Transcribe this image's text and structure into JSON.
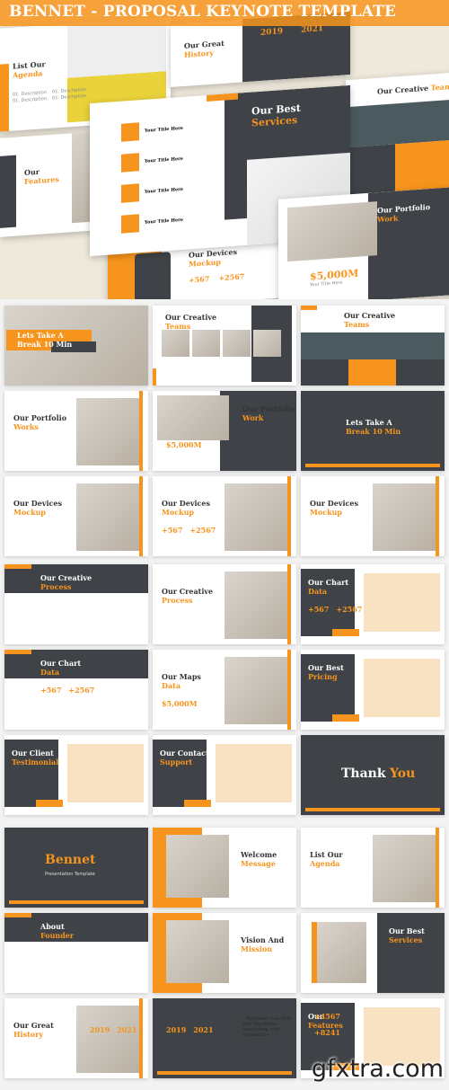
{
  "header": {
    "title": "BENNET - PROPOSAL KEYNOTE TEMPLATE"
  },
  "hero": {
    "agenda": {
      "t1": "List Our",
      "t2": "Agenda",
      "items": [
        "01. Description",
        "01. Description",
        "01. Description",
        "01. Description"
      ]
    },
    "history": {
      "t1": "Our Great",
      "t2": "History",
      "years": [
        "2019",
        "2021"
      ]
    },
    "services": {
      "t1": "Our Best",
      "t2": "Services",
      "items": [
        "Your Title Here",
        "Your Title Here",
        "Your Title Here",
        "Your Title Here"
      ]
    },
    "team": {
      "t1": "Our Creative",
      "t2": "Team"
    },
    "features": {
      "t1": "Our",
      "t2": "Features"
    },
    "devices": {
      "t1": "Our Devices",
      "t2": "Mockup",
      "stats": [
        "+567",
        "+2567"
      ]
    },
    "portfolio": {
      "t1": "Our Portfolio",
      "t2": "Work",
      "stat": "$5,000M",
      "sub": "Your Title Here"
    }
  },
  "slides": [
    {
      "t1": "Lets Take A",
      "t2": "Break 10 Min"
    },
    {
      "t1": "Our Creative",
      "t2": "Teams"
    },
    {
      "t1": "Our Creative",
      "t2": "Teams"
    },
    {
      "t1": "Our Portfolio",
      "t2": "Works"
    },
    {
      "t1": "Our Portfolio",
      "t2": "Work",
      "stats": [
        "$5,000M"
      ]
    },
    {
      "t1": "Lets Take A",
      "t2": "Break 10 Min"
    },
    {
      "t1": "Our Devices",
      "t2": "Mockup"
    },
    {
      "t1": "Our Devices",
      "t2": "Mockup",
      "stats": [
        "+567",
        "+2567"
      ]
    },
    {
      "t1": "Our Devices",
      "t2": "Mockup"
    },
    {
      "t1": "Our Creative",
      "t2": "Process"
    },
    {
      "t1": "Our Creative",
      "t2": "Process"
    },
    {
      "t1": "Our Chart",
      "t2": "Data",
      "stats": [
        "+567",
        "+2567"
      ]
    },
    {
      "t1": "Our Chart",
      "t2": "Data",
      "stats": [
        "+567",
        "+2567"
      ]
    },
    {
      "t1": "Our Maps",
      "t2": "Data",
      "stats": [
        "$5,000M"
      ]
    },
    {
      "t1": "Our Best",
      "t2": "Pricing"
    },
    {
      "t1": "Our Client",
      "t2": "Testimonial"
    },
    {
      "t1": "Our Contact",
      "t2": "Support"
    },
    {
      "t1": "Thank",
      "t2": "You"
    },
    {
      "t1": "",
      "t2": "Bennet",
      "sub": "Presentation Template"
    },
    {
      "t1": "Welcome",
      "t2": "Message"
    },
    {
      "t1": "List Our",
      "t2": "Agenda"
    },
    {
      "t1": "About",
      "t2": "Founder"
    },
    {
      "t1": "Vision And",
      "t2": "Mission"
    },
    {
      "t1": "Our Best",
      "t2": "Services"
    },
    {
      "t1": "Our Great",
      "t2": "History",
      "stats": [
        "2019",
        "2021"
      ]
    },
    {
      "t1": "",
      "t2": "",
      "stats": [
        "2019",
        "2021"
      ],
      "quote": "\" Business has only two functions — marketing and innovation \""
    },
    {
      "t1": "Our",
      "t2": "Features",
      "stats": [
        "+4567",
        "+8241"
      ]
    }
  ],
  "watermark": "gfxtra.com",
  "colors": {
    "accent": "#f7941d",
    "dark": "#3f4347"
  }
}
